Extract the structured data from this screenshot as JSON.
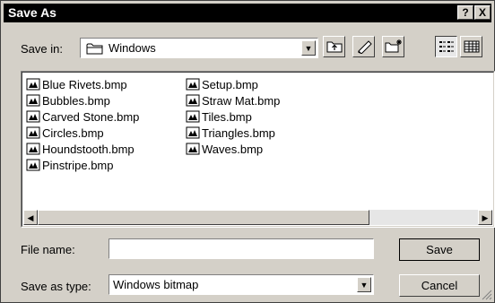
{
  "window": {
    "title": "Save As",
    "help_label": "?",
    "close_label": "X"
  },
  "save_in": {
    "label": "Save in:",
    "value": "Windows"
  },
  "files": {
    "column1": [
      "Blue Rivets.bmp",
      "Bubbles.bmp",
      "Carved Stone.bmp",
      "Circles.bmp",
      "Houndstooth.bmp",
      "Pinstripe.bmp"
    ],
    "column2": [
      "Setup.bmp",
      "Straw Mat.bmp",
      "Tiles.bmp",
      "Triangles.bmp",
      "Waves.bmp"
    ]
  },
  "file_name": {
    "label": "File name:",
    "value": ""
  },
  "save_as_type": {
    "label": "Save as type:",
    "value": "Windows bitmap"
  },
  "buttons": {
    "save": "Save",
    "cancel": "Cancel"
  },
  "icons": {
    "folder": "folder-icon",
    "up_one_level": "up-folder-icon",
    "desktop": "desktop-icon",
    "new_folder": "new-folder-icon",
    "list_view": "list-view-icon",
    "details_view": "details-view-icon",
    "bitmap_file": "bitmap-file-icon"
  },
  "colors": {
    "titlebar": "#000000",
    "face": "#d4d0c8",
    "window_bg": "#ffffff"
  }
}
